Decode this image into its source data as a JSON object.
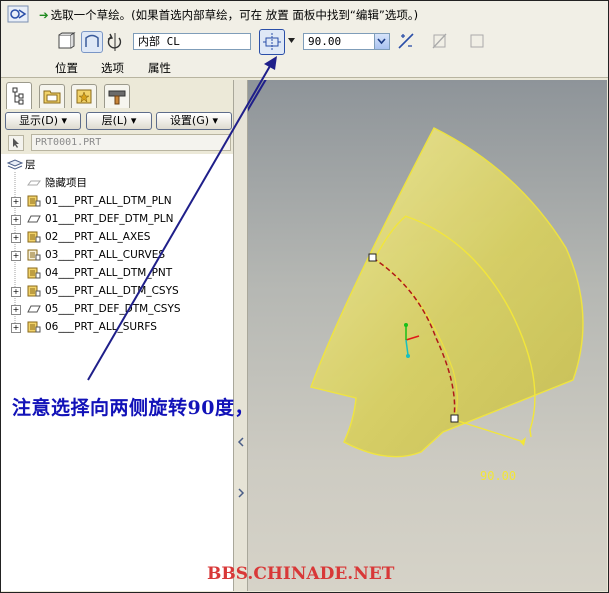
{
  "dashboard": {
    "prompt": "选取一个草绘。(如果首选内部草绘，可在 放置 面板中找到“编辑”选项。)",
    "sketch_field_value": "内部 CL",
    "angle_value": "90.00",
    "tabs": [
      {
        "label": "位置"
      },
      {
        "label": "选项"
      },
      {
        "label": "属性"
      }
    ]
  },
  "left_panel": {
    "show_button": "显示(D) ▾",
    "layer_button": "层(L) ▾",
    "settings_button": "设置(G) ▾",
    "model_name": "PRT0001.PRT",
    "tree_root": "层",
    "tree_items": [
      {
        "label": "隐藏项目",
        "expandable": false,
        "icon": "hidden-items-icon"
      },
      {
        "label": "01___PRT_ALL_DTM_PLN",
        "expandable": true,
        "icon": "layer-icon"
      },
      {
        "label": "01___PRT_DEF_DTM_PLN",
        "expandable": true,
        "icon": "plane-icon"
      },
      {
        "label": "02___PRT_ALL_AXES",
        "expandable": true,
        "icon": "layer-icon"
      },
      {
        "label": "03___PRT_ALL_CURVES",
        "expandable": true,
        "icon": "layer-faded-icon"
      },
      {
        "label": "04___PRT_ALL_DTM_PNT",
        "expandable": false,
        "icon": "layer-icon"
      },
      {
        "label": "05___PRT_ALL_DTM_CSYS",
        "expandable": true,
        "icon": "layer-icon"
      },
      {
        "label": "05___PRT_DEF_DTM_CSYS",
        "expandable": true,
        "icon": "plane-icon"
      },
      {
        "label": "06___PRT_ALL_SURFS",
        "expandable": true,
        "icon": "layer-icon"
      }
    ]
  },
  "viewport": {
    "dimension_label": "90.00",
    "annotation": "注意选择向两侧旋转90度，"
  },
  "watermark": "BBS.CHINADE.NET",
  "colors": {
    "annotation": "#1212b8",
    "watermark": "#d83838",
    "surface_fill": "#d9d16c",
    "surface_edge": "#f2e63a",
    "sketch_curve": "#b01818"
  }
}
